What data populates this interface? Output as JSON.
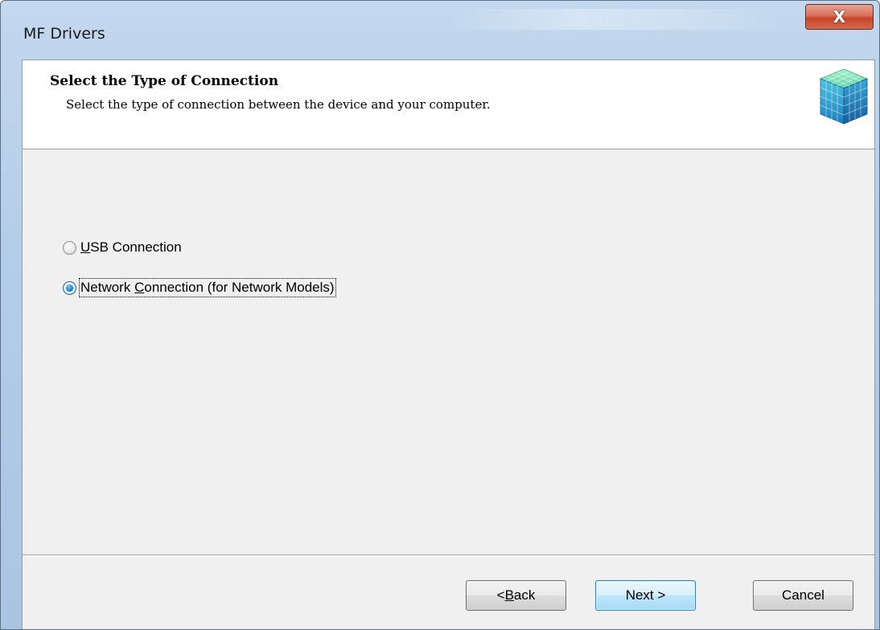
{
  "window": {
    "title": "MF Drivers",
    "close_glyph": "X"
  },
  "header": {
    "title": "Select the Type of Connection",
    "subtitle": "Select the type of connection between the device and your computer.",
    "icon": "cube-blocks-icon"
  },
  "options": [
    {
      "label_prefix": "",
      "label_mnemonic": "U",
      "label_rest": "SB Connection",
      "checked": false
    },
    {
      "label_prefix": "Network ",
      "label_mnemonic": "C",
      "label_rest": "onnection (for Network Models)",
      "checked": true
    }
  ],
  "buttons": {
    "back": {
      "prefix": "< ",
      "mnemonic": "B",
      "rest": "ack"
    },
    "next": {
      "label": "Next >"
    },
    "cancel": {
      "label": "Cancel"
    }
  },
  "colors": {
    "client_bg": "#f0f0f0",
    "frame": "#b4cde8",
    "close_red": "#c8442a",
    "default_button": "#3c7fb1"
  }
}
